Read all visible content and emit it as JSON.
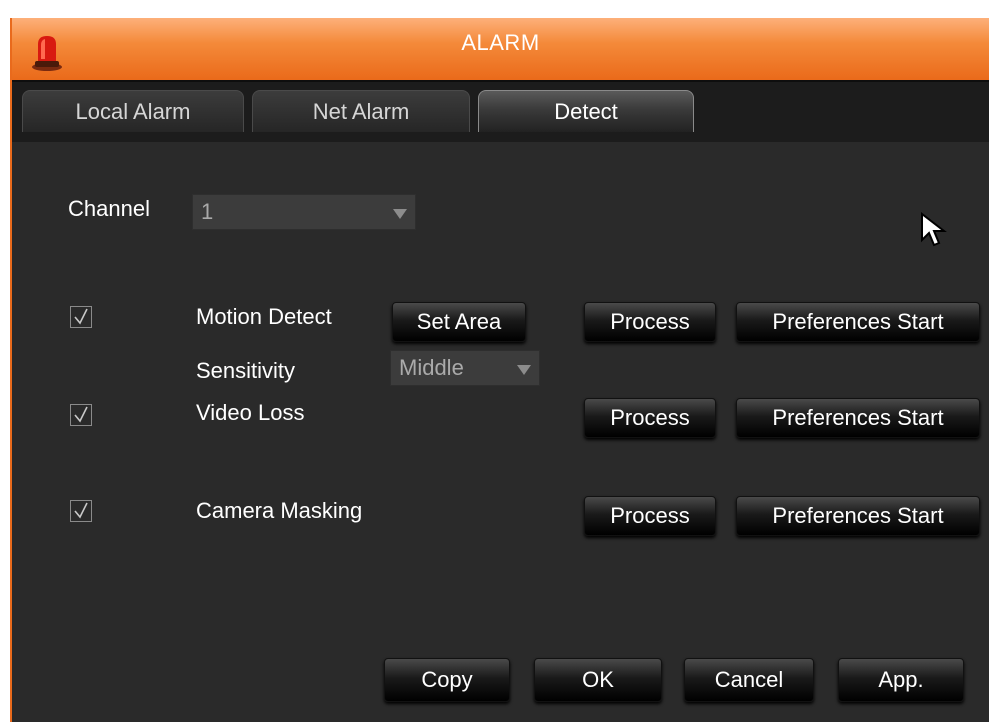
{
  "window": {
    "title": "ALARM"
  },
  "tabs": [
    {
      "label": "Local Alarm",
      "active": false
    },
    {
      "label": "Net Alarm",
      "active": false
    },
    {
      "label": "Detect",
      "active": true
    }
  ],
  "channel": {
    "label": "Channel",
    "value": "1"
  },
  "detects": [
    {
      "label": "Motion Detect",
      "checked": true,
      "set_area_label": "Set Area",
      "process_label": "Process",
      "preferences_label": "Preferences Start"
    },
    {
      "label": "Video Loss",
      "checked": true,
      "process_label": "Process",
      "preferences_label": "Preferences Start"
    },
    {
      "label": "Camera Masking",
      "checked": true,
      "process_label": "Process",
      "preferences_label": "Preferences Start"
    }
  ],
  "sensitivity": {
    "label": "Sensitivity",
    "value": "Middle"
  },
  "footer": {
    "copy": "Copy",
    "ok": "OK",
    "cancel": "Cancel",
    "apply": "App."
  },
  "colors": {
    "title_orange": "#f48a3a",
    "panel_bg": "#2a2a2a",
    "tab_bg": "#1c1c1c"
  }
}
